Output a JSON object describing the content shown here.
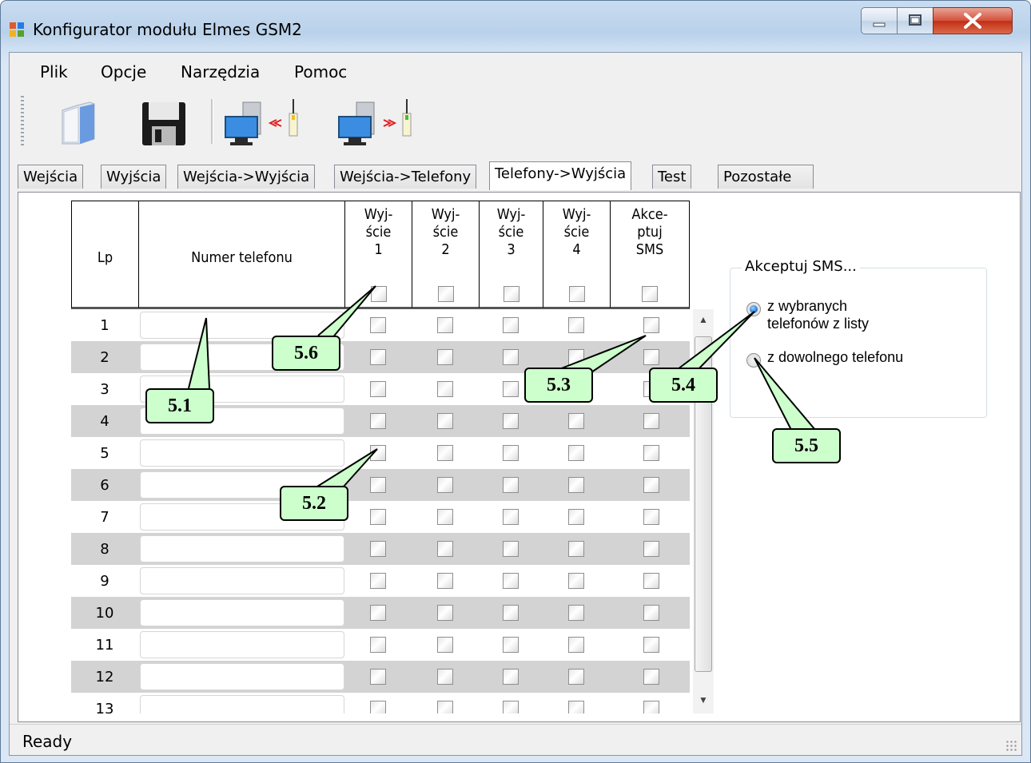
{
  "window": {
    "title": "Konfigurator modułu Elmes GSM2",
    "controls": [
      "minimize",
      "maximize",
      "close"
    ]
  },
  "menu": {
    "items": [
      "Plik",
      "Opcje",
      "Narzędzia",
      "Pomoc"
    ]
  },
  "toolbar": {
    "buttons": [
      "open-file-icon",
      "save-icon",
      "read-from-device-icon",
      "write-to-device-icon"
    ]
  },
  "tabs": {
    "items": [
      "Wejścia",
      "Wyjścia",
      "Wejścia->Wyjścia",
      "Wejścia->Telefony",
      "Telefony->Wyjścia",
      "Test",
      "Pozostałe"
    ],
    "active": "Telefony->Wyjścia"
  },
  "grid": {
    "headers": {
      "lp": "Lp",
      "phone": "Numer telefonu",
      "out1": [
        "Wyj-",
        "ście",
        "1"
      ],
      "out2": [
        "Wyj-",
        "ście",
        "2"
      ],
      "out3": [
        "Wyj-",
        "ście",
        "3"
      ],
      "out4": [
        "Wyj-",
        "ście",
        "4"
      ],
      "sms": [
        "Akce-",
        "ptuj",
        "SMS"
      ]
    },
    "rows": [
      "1",
      "2",
      "3",
      "4",
      "5",
      "6",
      "7",
      "8",
      "9",
      "10",
      "11",
      "12",
      "13"
    ],
    "phone_values": [
      "",
      "",
      "",
      "",
      "",
      "",
      "",
      "",
      "",
      "",
      "",
      "",
      ""
    ]
  },
  "sms_group": {
    "title": "Akceptuj SMS...",
    "options": [
      {
        "label_line1": "z wybranych",
        "label_line2": "telefonów z listy",
        "selected": true
      },
      {
        "label_line1": "z dowolnego telefonu",
        "label_line2": "",
        "selected": false
      }
    ]
  },
  "statusbar": {
    "text": "Ready"
  },
  "callouts": {
    "c51": "5.1",
    "c52": "5.2",
    "c53": "5.3",
    "c54": "5.4",
    "c55": "5.5",
    "c56": "5.6"
  },
  "colors": {
    "callout_fill": "#ccffcc",
    "row_alt": "#d3d3d3",
    "close_button": "#c12e16"
  }
}
